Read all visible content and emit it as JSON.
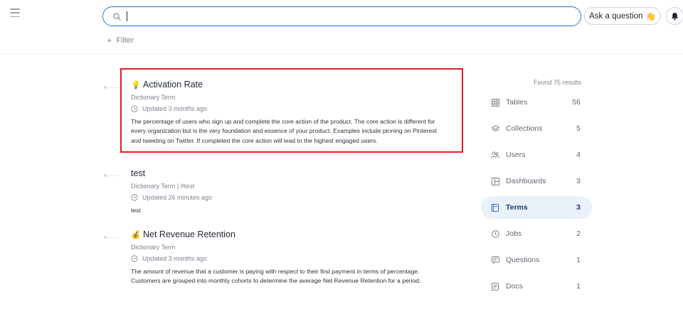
{
  "search": {
    "value": "",
    "placeholder": ""
  },
  "header": {
    "ask_label": "Ask a question",
    "ask_emoji": "👋"
  },
  "filter": {
    "plus": "+",
    "label": "Filter"
  },
  "results": [
    {
      "emoji": "💡",
      "title": "Activation Rate",
      "type": "Dictionary Term",
      "updated": "Updated 3 months ago",
      "description": "The percentage of users who sign up and complete the core action of the product. The core action is different for every organization but is the very foundation and essence of your product. Examples include pinning on Pinterest and tweeting on Twitter. If completed the core action will lead to the highest engaged users."
    },
    {
      "emoji": "",
      "title": "test",
      "type": "Dictionary Term | #test",
      "updated": "Updated 26 minutes ago",
      "description": "test"
    },
    {
      "emoji": "💰",
      "title": "Net Revenue Retention",
      "type": "Dictionary Term",
      "updated": "Updated 3 months ago",
      "description": "The amount of revenue that a customer is paying with respect to their first payment in terms of percentage. Customers are grouped into monthly cohorts to determine the average Net Revenue Retention for a period."
    }
  ],
  "sidebar": {
    "found": "Found 75 results",
    "facets": [
      {
        "label": "Tables",
        "count": "56",
        "icon": "table-icon"
      },
      {
        "label": "Collections",
        "count": "5",
        "icon": "collection-icon"
      },
      {
        "label": "Users",
        "count": "4",
        "icon": "users-icon"
      },
      {
        "label": "Dashboards",
        "count": "3",
        "icon": "dashboard-icon"
      },
      {
        "label": "Terms",
        "count": "3",
        "icon": "book-icon"
      },
      {
        "label": "Jobs",
        "count": "2",
        "icon": "clock-icon"
      },
      {
        "label": "Questions",
        "count": "1",
        "icon": "question-icon"
      },
      {
        "label": "Docs",
        "count": "1",
        "icon": "doc-icon"
      }
    ],
    "active_facet": "Terms"
  },
  "colors": {
    "accent": "#2f6fd6",
    "highlight_border": "#e11d24",
    "active_bg": "#e9f1fb",
    "muted_text": "#7b8590"
  }
}
